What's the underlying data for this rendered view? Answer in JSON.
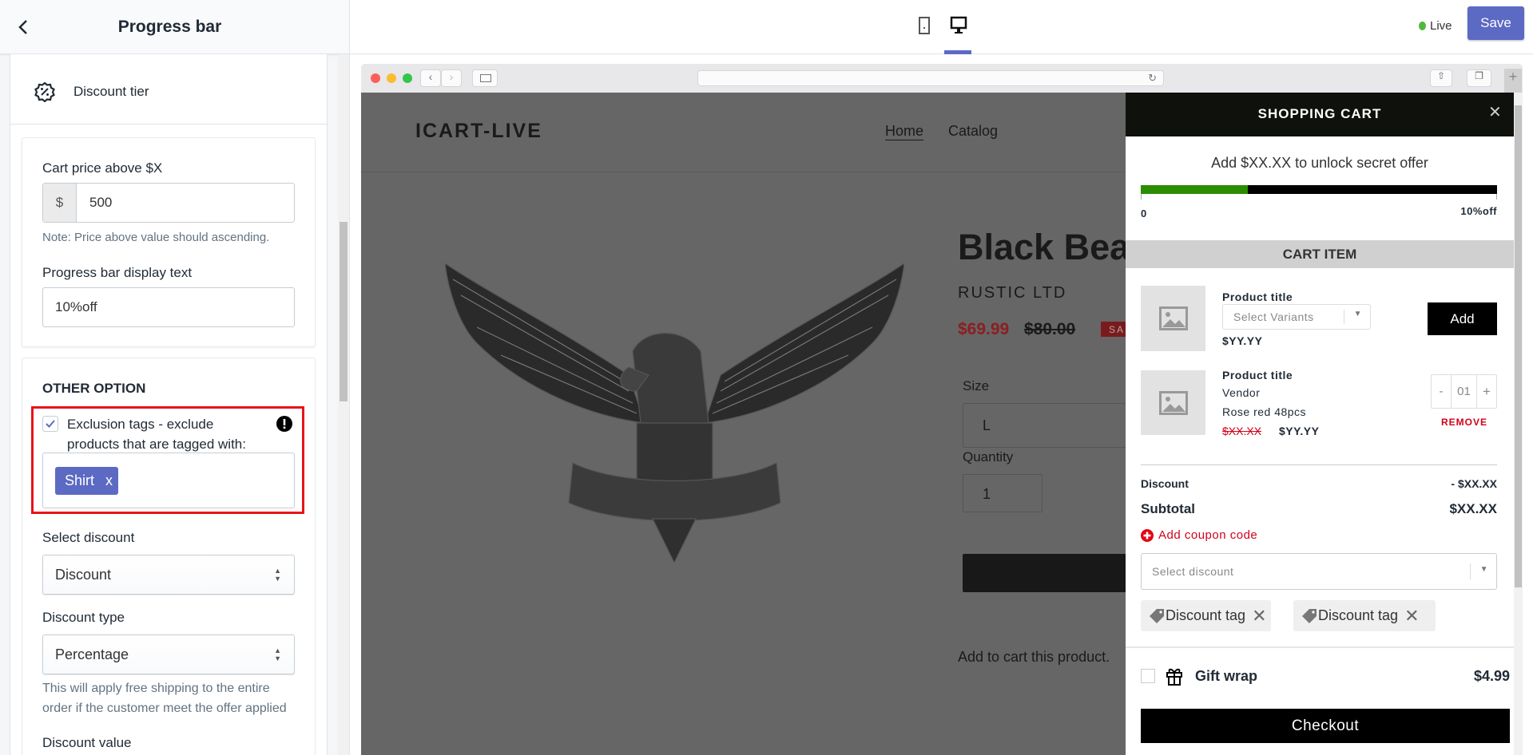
{
  "left": {
    "title": "Progress bar",
    "section": "Discount tier",
    "cart_price_label": "Cart price above $X",
    "currency": "$",
    "cart_price_value": "500",
    "cart_price_note": "Note: Price above value should ascending.",
    "display_text_label": "Progress bar display text",
    "display_text_value": "10%off",
    "other_option": "OTHER OPTION",
    "exclusion_checked": true,
    "exclusion_line1": "Exclusion tags  - exclude",
    "exclusion_line2": "products that are tagged with:",
    "tags": [
      {
        "label": "Shirt",
        "remove": "x"
      }
    ],
    "select_discount_label": "Select discount",
    "select_discount_value": "Discount",
    "discount_type_label": "Discount type",
    "discount_type_value": "Percentage",
    "discount_type_help1": "This will apply free shipping to the entire",
    "discount_type_help2": "order if the customer meet the offer applied",
    "discount_value_label": "Discount value"
  },
  "top": {
    "live": "Live",
    "save": "Save",
    "active_device": "desktop",
    "colors": {
      "accent": "#5c6ac4",
      "live": "#50b83c"
    }
  },
  "site": {
    "logo": "ICART-LIVE",
    "nav": [
      "Home",
      "Catalog"
    ],
    "product_title": "Black Bea",
    "vendor": "RUSTIC LTD",
    "price": "$69.99",
    "compare_price": "$80.00",
    "badge": "SA",
    "size_label": "Size",
    "size_value": "L",
    "quantity_label": "Quantity",
    "quantity_value": "1",
    "description": "Add to cart this product."
  },
  "cart": {
    "title": "SHOPPING CART",
    "close": "✕",
    "progress_text": "Add $XX.XX to unlock secret offer",
    "progress_fraction": 0.3,
    "progress_start": "0",
    "progress_end": "10%off",
    "section": "CART ITEM",
    "item1": {
      "title": "Product title",
      "variant_placeholder": "Select Variants",
      "price": "$YY.YY",
      "add": "Add"
    },
    "item2": {
      "title": "Product title",
      "vendor": "Vendor",
      "variant": "Rose red 48pcs",
      "old_price": "$XX.XX",
      "price": "$YY.YY",
      "qty": "01",
      "minus": "-",
      "plus": "+",
      "remove": "REMOVE"
    },
    "discount_label": "Discount",
    "discount_value": "- $XX.XX",
    "subtotal_label": "Subtotal",
    "subtotal_value": "$XX.XX",
    "coupon": "Add coupon code",
    "select_discount": "Select discount",
    "tags": [
      "Discount tag",
      "Discount tag"
    ],
    "gift_wrap": "Gift wrap",
    "gift_price": "$4.99",
    "checkout": "Checkout",
    "colors": {
      "progress": "#2d8c00",
      "remove": "#d0021b"
    }
  }
}
